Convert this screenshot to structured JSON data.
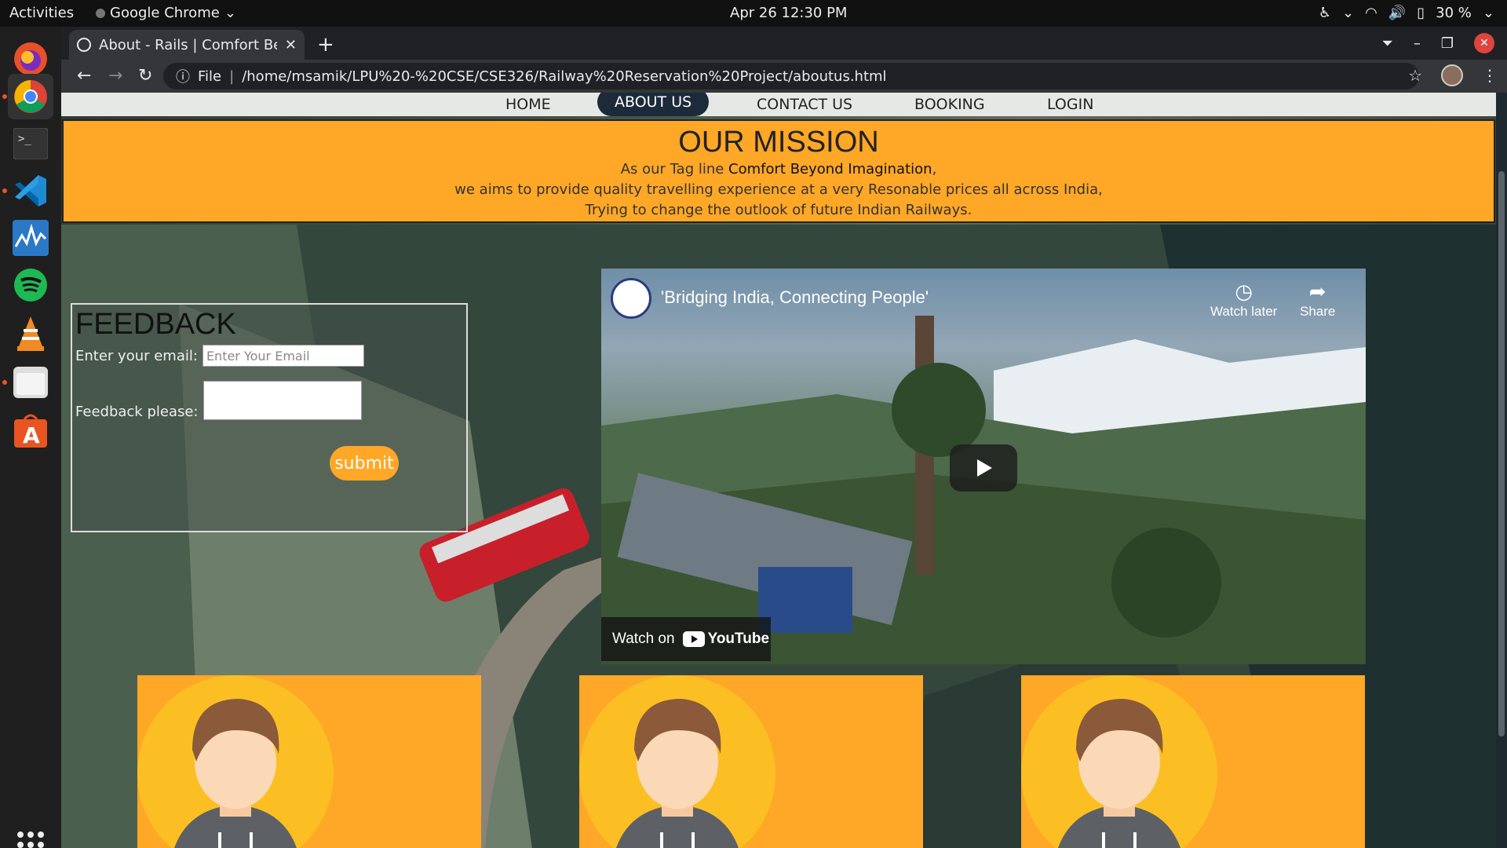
{
  "system": {
    "activities": "Activities",
    "app_name": "Google Chrome",
    "clock": "Apr 26  12:30 PM",
    "battery": "30 %"
  },
  "browser": {
    "tab_title": "About - Rails | Comfort Be",
    "url_scheme": "File",
    "url": "/home/msamik/LPU%20-%20CSE/CSE326/Railway%20Reservation%20Project/aboutus.html"
  },
  "nav": {
    "items": [
      "HOME",
      "ABOUT US",
      "CONTACT US",
      "BOOKING",
      "LOGIN"
    ],
    "active": "ABOUT US"
  },
  "mission": {
    "title": "OUR MISSION",
    "line1_prefix": "As our Tag line ",
    "line1_tagline": "Comfort Beyond Imagination",
    "line1_suffix": ",",
    "line2": "we aims to provide quality travelling experience at a very Resonable prices all across India,",
    "line3": "Trying to change the outlook of future Indian Railways."
  },
  "feedback": {
    "title": "FEEDBACK",
    "email_label": "Enter your email:",
    "email_placeholder": "Enter Your Email",
    "feedback_label": "Feedback please:",
    "submit": "submit"
  },
  "video": {
    "title": "'Bridging India, Connecting People'",
    "watch_later": "Watch later",
    "share": "Share",
    "watch_on": "Watch on",
    "youtube": "YouTube"
  },
  "team_cards": 3
}
